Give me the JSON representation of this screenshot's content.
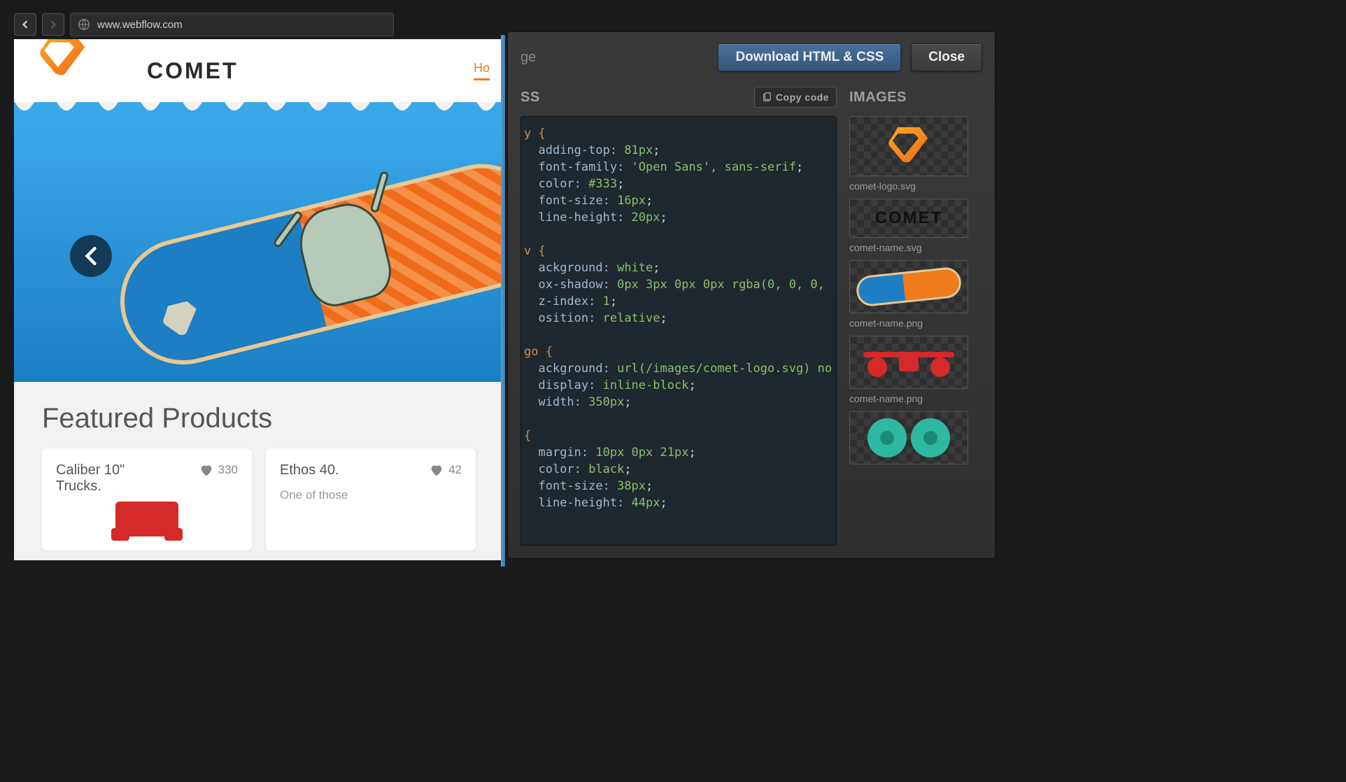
{
  "browser": {
    "url": "www.webflow.com"
  },
  "site": {
    "brand": "COMET",
    "nav_home": "Ho",
    "featured_heading": "Featured Products",
    "products": [
      {
        "title": "Caliber 10\" Trucks.",
        "likes": "330",
        "desc": ""
      },
      {
        "title": "Ethos 40.",
        "likes": "42",
        "desc": "One of those"
      }
    ]
  },
  "panel": {
    "crumb_suffix": "ge",
    "download_label": "Download HTML & CSS",
    "close_label": "Close",
    "css_heading": "SS",
    "copy_label": "Copy code",
    "images_heading": "IMAGES",
    "images": [
      {
        "label": "comet-logo.svg"
      },
      {
        "label": "comet-name.svg"
      },
      {
        "label": "comet-name.png"
      },
      {
        "label": "comet-name.png"
      }
    ],
    "css_lines": [
      [
        "sel",
        "y {"
      ],
      [
        "prop",
        "adding-top: ",
        "81px",
        ";"
      ],
      [
        "prop",
        "font-family: ",
        "'Open Sans', sans-serif",
        ";"
      ],
      [
        "prop",
        "color: ",
        "#333",
        ";"
      ],
      [
        "prop",
        "font-size: ",
        "16px",
        ";"
      ],
      [
        "prop",
        "line-height: ",
        "20px",
        ";"
      ],
      [
        "blank",
        ""
      ],
      [
        "sel",
        "v {"
      ],
      [
        "prop",
        "ackground: ",
        "white",
        ";"
      ],
      [
        "prop",
        "ox-shadow: ",
        "0px 3px 0px 0px rgba(0, 0, 0,",
        ""
      ],
      [
        "prop",
        "z-index: ",
        "1",
        ";"
      ],
      [
        "prop",
        "osition: ",
        "relative",
        ";"
      ],
      [
        "blank",
        ""
      ],
      [
        "sel",
        "go {"
      ],
      [
        "prop",
        "ackground: ",
        "url(/images/comet-logo.svg) no",
        ""
      ],
      [
        "prop",
        "display: ",
        "inline-block",
        ";"
      ],
      [
        "prop",
        "width: ",
        "350px",
        ";"
      ],
      [
        "blank",
        ""
      ],
      [
        "sel",
        "{"
      ],
      [
        "prop",
        "margin: ",
        "10px 0px 21px",
        ";"
      ],
      [
        "prop",
        "color: ",
        "black",
        ";"
      ],
      [
        "prop",
        "font-size: ",
        "38px",
        ";"
      ],
      [
        "prop",
        "line-height: ",
        "44px",
        ";"
      ]
    ]
  }
}
